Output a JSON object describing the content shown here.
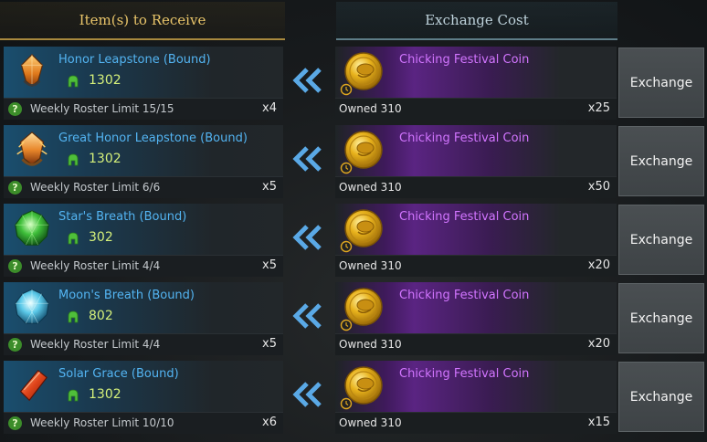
{
  "header": {
    "receive_title": "Item(s) to Receive",
    "cost_title": "Exchange Cost"
  },
  "colors": {
    "item_name": "#53b4f2",
    "coin_name": "#d275ff",
    "points": "#d5f07a",
    "receive_header": "#e9c56a"
  },
  "rows": [
    {
      "item": {
        "name": "Honor Leapstone (Bound)",
        "icon": "honor-leapstone-icon",
        "points": "1302",
        "limit": "Weekly Roster Limit 15/15",
        "qty": "x4"
      },
      "cost": {
        "name": "Chicking Festival Coin",
        "icon": "festival-coin-icon",
        "owned": "Owned 310",
        "qty": "x25"
      },
      "button": "Exchange"
    },
    {
      "item": {
        "name": "Great Honor Leapstone (Bound)",
        "icon": "great-honor-leapstone-icon",
        "points": "1302",
        "limit": "Weekly Roster Limit 6/6",
        "qty": "x5"
      },
      "cost": {
        "name": "Chicking Festival Coin",
        "icon": "festival-coin-icon",
        "owned": "Owned 310",
        "qty": "x50"
      },
      "button": "Exchange"
    },
    {
      "item": {
        "name": "Star's Breath (Bound)",
        "icon": "stars-breath-icon",
        "points": "302",
        "limit": "Weekly Roster Limit 4/4",
        "qty": "x5"
      },
      "cost": {
        "name": "Chicking Festival Coin",
        "icon": "festival-coin-icon",
        "owned": "Owned 310",
        "qty": "x20"
      },
      "button": "Exchange"
    },
    {
      "item": {
        "name": "Moon's Breath (Bound)",
        "icon": "moons-breath-icon",
        "points": "802",
        "limit": "Weekly Roster Limit 4/4",
        "qty": "x5"
      },
      "cost": {
        "name": "Chicking Festival Coin",
        "icon": "festival-coin-icon",
        "owned": "Owned 310",
        "qty": "x20"
      },
      "button": "Exchange"
    },
    {
      "item": {
        "name": "Solar Grace (Bound)",
        "icon": "solar-grace-icon",
        "points": "1302",
        "limit": "Weekly Roster Limit 10/10",
        "qty": "x6"
      },
      "cost": {
        "name": "Chicking Festival Coin",
        "icon": "festival-coin-icon",
        "owned": "Owned 310",
        "qty": "x15"
      },
      "button": "Exchange"
    }
  ]
}
